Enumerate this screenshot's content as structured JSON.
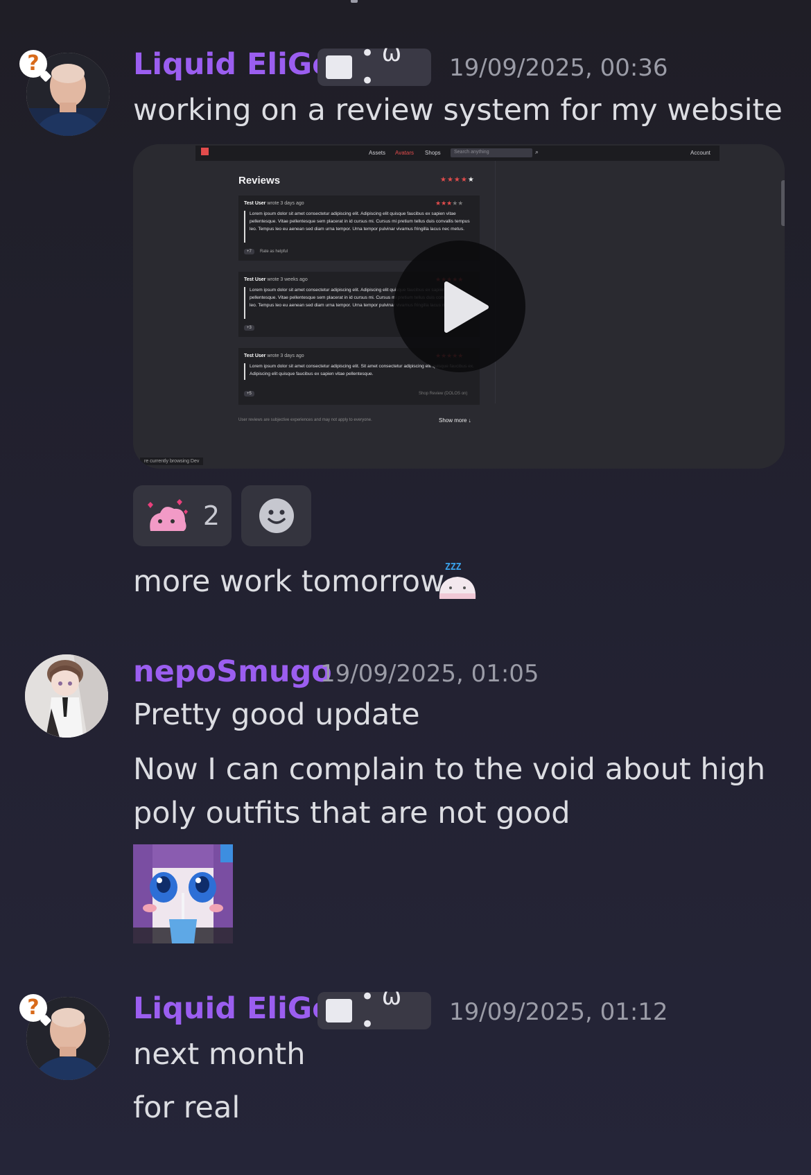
{
  "colors": {
    "username": "#9b5ef0",
    "accent_red": "#e24c4c",
    "background": "#222130"
  },
  "messages": [
    {
      "author": "Liquid EliGe",
      "tag": "• ω •",
      "timestamp": "19/09/2025, 00:36",
      "lines": [
        "working on a review system for my website"
      ],
      "video": {
        "nav": [
          "Assets",
          "Avatars",
          "Shops"
        ],
        "search_placeholder": "Search anything",
        "account": "Account",
        "heading": "Reviews",
        "reviews": [
          {
            "user": "Test User",
            "when": "wrote 3 days ago",
            "body": "Lorem ipsum dolor sit amet consectetur adipiscing elit. Adipiscing elit quisque faucibus ex sapien vitae pellentesque. Vitae pellentesque sem placerat in id cursus mi. Cursus mi pretium tellus duis convallis tempus leo. Tempus leo eu aenean sed diam urna tempor. Urna tempor pulvinar vivamus fringilla lacus nec metus.",
            "count": "+7",
            "helpful": "Rate as helpful"
          },
          {
            "user": "Test User",
            "when": "wrote 3 weeks ago",
            "body": "Lorem ipsum dolor sit amet consectetur adipiscing elit. Adipiscing elit quisque faucibus ex sapien vitae pellentesque. Vitae pellentesque sem placerat in id cursus mi. Cursus mi pretium tellus duis convallis tempus leo. Tempus leo eu aenean sed diam urna tempor. Urna tempor pulvinar vivamus fringilla lacus nec metus.",
            "count": "+3"
          },
          {
            "user": "Test User",
            "when": "wrote 3 days ago",
            "body": "Lorem ipsum dolor sit amet consectetur adipiscing elit. Sit amet consectetur adipiscing elit quisque faucibus ex. Adipiscing elit quisque faucibus ex sapien vitae pellentesque.",
            "count": "+5",
            "meta": "Shop Review (DOLOS on)"
          }
        ],
        "disclaimer": "User reviews are subjective experiences and may not apply to everyone.",
        "show_more": "Show more ↓",
        "status": "re currently browsing Dev"
      },
      "reactions": [
        {
          "emoji": "pink-blob-hearts",
          "count": "2"
        }
      ],
      "followup": "more work tomorrow"
    },
    {
      "author": "nepoSmugo",
      "timestamp": "19/09/2025, 01:05",
      "lines": [
        "Pretty good update",
        "Now I can complain to the void about high",
        "poly outfits that are not good"
      ]
    },
    {
      "author": "Liquid EliGe",
      "tag": "• ω •",
      "timestamp": "19/09/2025, 01:12",
      "lines": [
        "next month",
        "for real"
      ]
    }
  ]
}
